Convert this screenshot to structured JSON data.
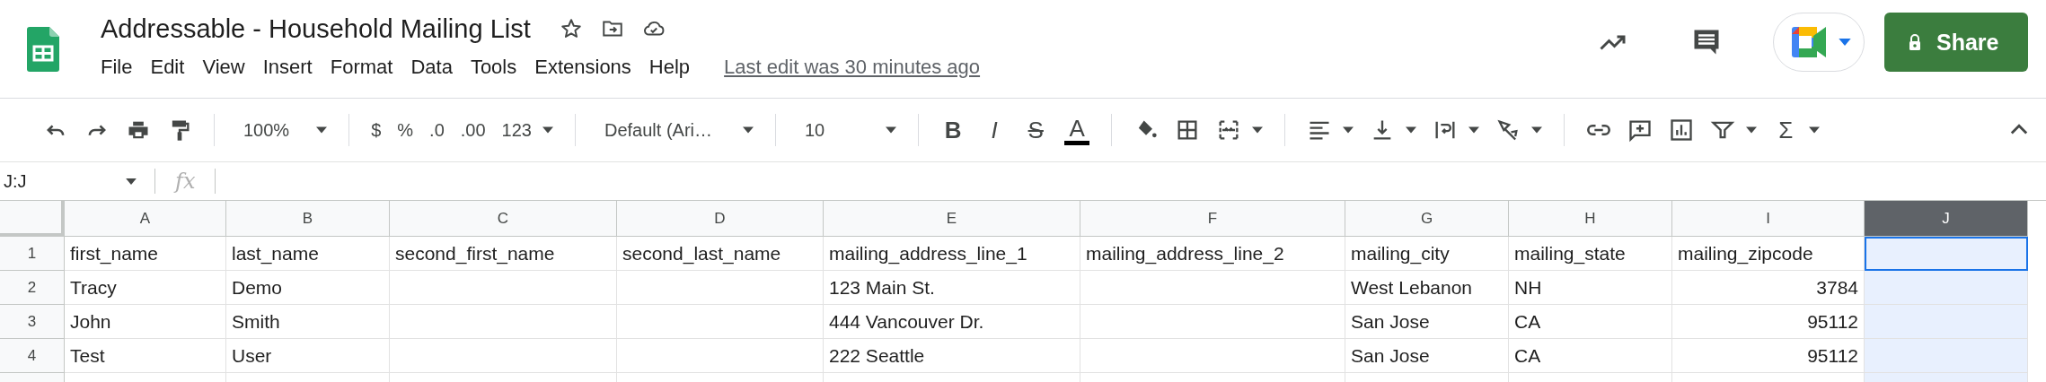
{
  "document": {
    "title": "Addressable - Household Mailing List",
    "last_edit": "Last edit was 30 minutes ago"
  },
  "menu": [
    "File",
    "Edit",
    "View",
    "Insert",
    "Format",
    "Data",
    "Tools",
    "Extensions",
    "Help"
  ],
  "share_button": {
    "label": "Share"
  },
  "toolbar": {
    "zoom": "100%",
    "currency": "$",
    "percent": "%",
    "decrease_decimals": ".0",
    "increase_decimals": ".00",
    "more_formats": "123",
    "font": "Default (Ari…",
    "font_size": "10",
    "bold": "B",
    "italic": "I",
    "strikethrough": "S",
    "text_color": "A",
    "functions": "Σ"
  },
  "formula_bar": {
    "name_box": "J:J",
    "fx": "fx"
  },
  "columns": [
    {
      "letter": "A",
      "kind": "text",
      "selected": false
    },
    {
      "letter": "B",
      "kind": "text",
      "selected": false
    },
    {
      "letter": "C",
      "kind": "text",
      "selected": false
    },
    {
      "letter": "D",
      "kind": "text",
      "selected": false
    },
    {
      "letter": "E",
      "kind": "text",
      "selected": false
    },
    {
      "letter": "F",
      "kind": "text",
      "selected": false
    },
    {
      "letter": "G",
      "kind": "text",
      "selected": false
    },
    {
      "letter": "H",
      "kind": "text",
      "selected": false
    },
    {
      "letter": "I",
      "kind": "number",
      "selected": false
    },
    {
      "letter": "J",
      "kind": "text",
      "selected": true
    }
  ],
  "rows": [
    {
      "number": "1",
      "kind": "header",
      "active": true,
      "cells": [
        "first_name",
        "last_name",
        "second_first_name",
        "second_last_name",
        "mailing_address_line_1",
        "mailing_address_line_2",
        "mailing_city",
        "mailing_state",
        "mailing_zipcode",
        null
      ]
    },
    {
      "number": "2",
      "kind": "data",
      "active": false,
      "cells": [
        "Tracy",
        "Demo",
        null,
        null,
        "123 Main St.",
        null,
        "West Lebanon",
        "NH",
        "3784",
        null
      ]
    },
    {
      "number": "3",
      "kind": "data",
      "active": false,
      "cells": [
        "John",
        "Smith",
        null,
        null,
        "444 Vancouver Dr.",
        null,
        "San Jose",
        "CA",
        "95112",
        null
      ]
    },
    {
      "number": "4",
      "kind": "data",
      "active": false,
      "cells": [
        "Test",
        "User",
        null,
        null,
        "222 Seattle",
        null,
        "San Jose",
        "CA",
        "95112",
        null
      ]
    }
  ]
}
